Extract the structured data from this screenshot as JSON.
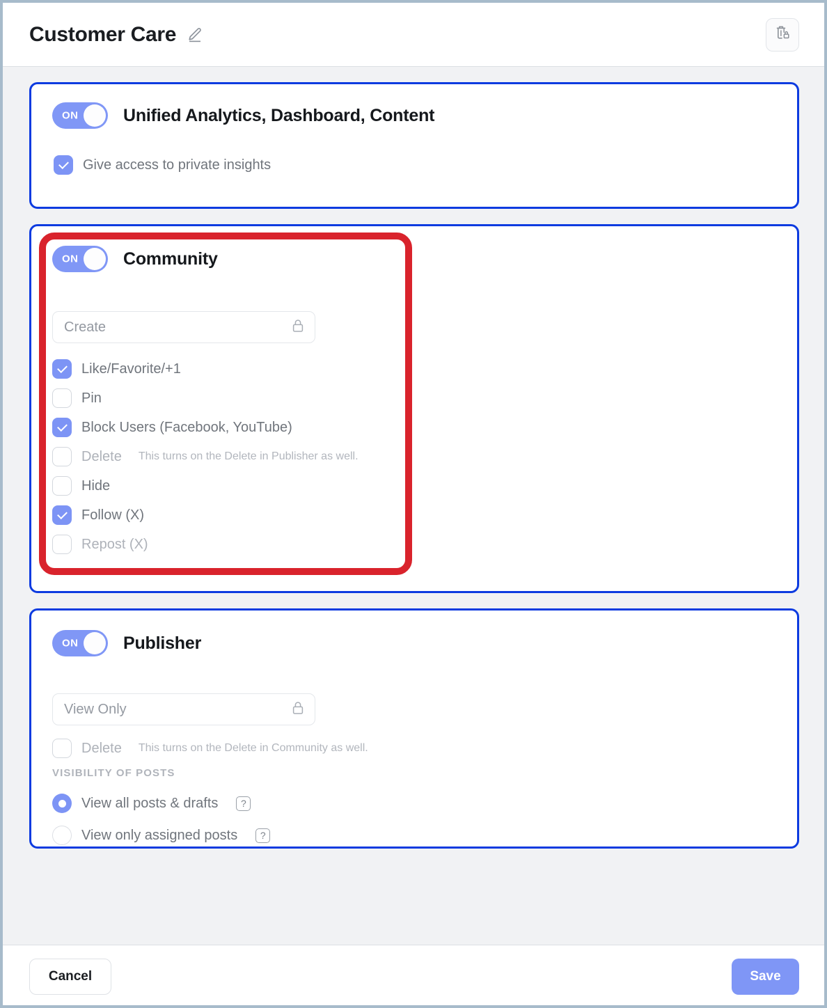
{
  "header": {
    "title": "Customer Care",
    "edit_icon": "pencil-icon",
    "delete_icon": "trash-lock-icon"
  },
  "cards": [
    {
      "id": "unified-analytics",
      "toggle": {
        "label": "ON",
        "state": "on"
      },
      "title": "Unified Analytics, Dashboard, Content",
      "checkboxes": [
        {
          "label": "Give access to private insights",
          "checked": true
        }
      ]
    },
    {
      "id": "community",
      "toggle": {
        "label": "ON",
        "state": "on"
      },
      "title": "Community",
      "select": {
        "value": "Create",
        "locked": true,
        "lock_icon": "lock-icon"
      },
      "checkboxes": [
        {
          "label": "Like/Favorite/+1",
          "checked": true,
          "hint": ""
        },
        {
          "label": "Pin",
          "checked": false,
          "hint": ""
        },
        {
          "label": "Block Users (Facebook, YouTube)",
          "checked": true,
          "hint": ""
        },
        {
          "label": "Delete",
          "checked": false,
          "hint": "This turns on the Delete in Publisher as well."
        },
        {
          "label": "Hide",
          "checked": false,
          "hint": ""
        },
        {
          "label": "Follow (X)",
          "checked": true,
          "hint": ""
        },
        {
          "label": "Repost (X)",
          "checked": false,
          "hint": ""
        }
      ]
    },
    {
      "id": "publisher",
      "toggle": {
        "label": "ON",
        "state": "on"
      },
      "title": "Publisher",
      "select": {
        "value": "View Only",
        "locked": true,
        "lock_icon": "lock-icon"
      },
      "checkboxes": [
        {
          "label": "Delete",
          "checked": false,
          "hint": "This turns on the Delete in Community as well."
        }
      ],
      "section_label": "VISIBILITY OF POSTS",
      "radios": [
        {
          "label": "View all posts & drafts",
          "selected": true,
          "help": "?"
        },
        {
          "label": "View only assigned posts",
          "selected": false,
          "help": "?"
        }
      ]
    }
  ],
  "footer": {
    "cancel_label": "Cancel",
    "save_label": "Save"
  },
  "annotation": {
    "type": "red-highlight-box",
    "target": "community-card-controls"
  },
  "colors": {
    "toggle_on": "#7f96f6",
    "checkbox_on": "#7d94f5",
    "card_border": "#0d3be0",
    "annotation_red": "#d9232c",
    "save_button": "#7f96f6",
    "page_background": "#f1f2f4",
    "outer_border": "#a7bbcb"
  }
}
